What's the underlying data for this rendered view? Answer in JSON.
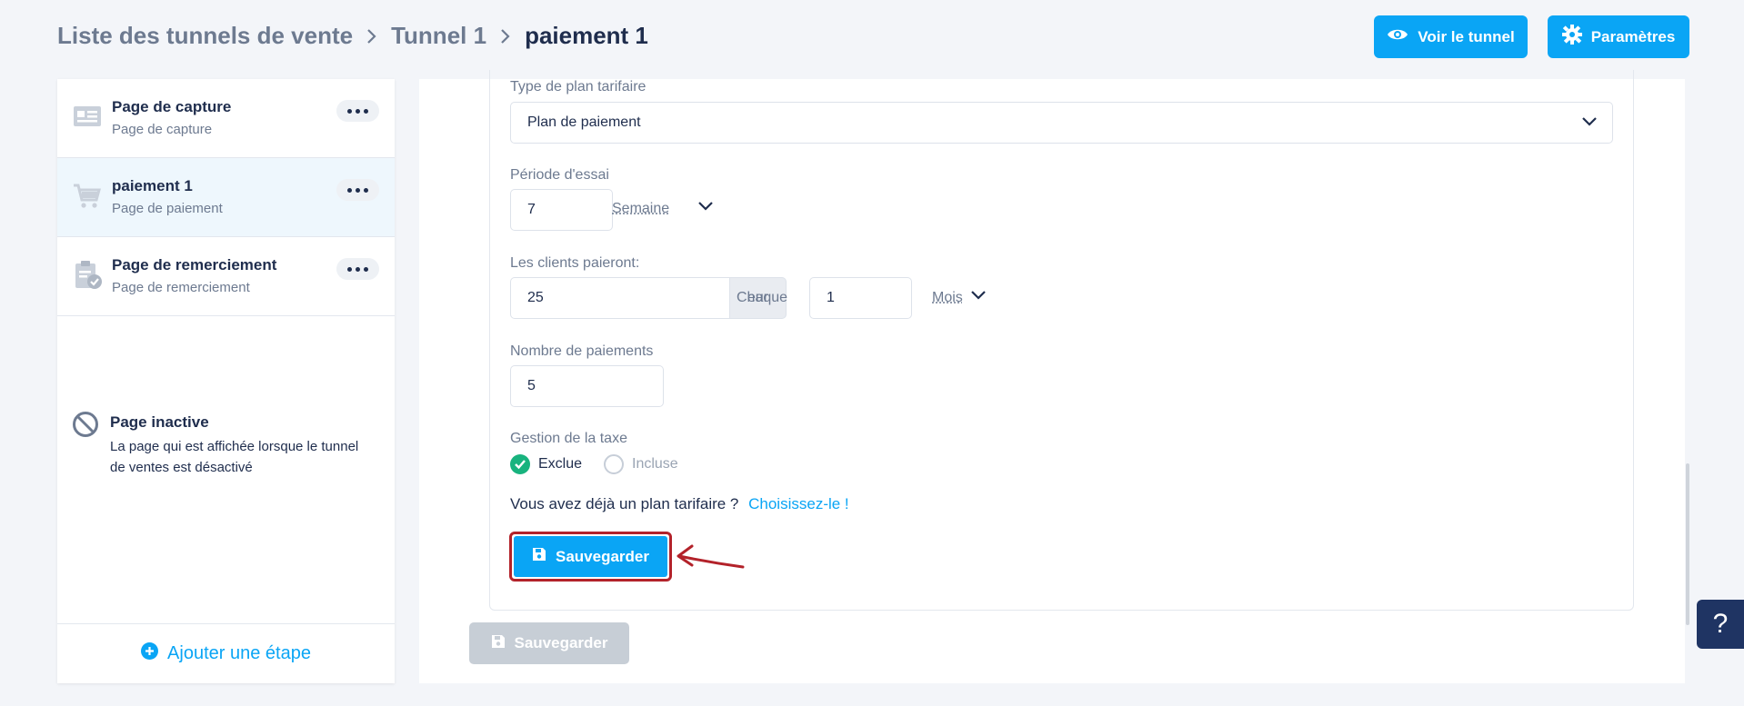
{
  "breadcrumb": {
    "items": [
      "Liste des tunnels de vente",
      "Tunnel 1"
    ],
    "current": "paiement 1"
  },
  "header": {
    "view_label": "Voir le tunnel",
    "settings_label": "Paramètres"
  },
  "sidebar": {
    "steps": [
      {
        "title": "Page de capture",
        "subtitle": "Page de capture",
        "icon": "capture-page-icon"
      },
      {
        "title": "paiement 1",
        "subtitle": "Page de paiement",
        "icon": "cart-icon"
      },
      {
        "title": "Page de remerciement",
        "subtitle": "Page de remerciement",
        "icon": "clipboard-check-icon"
      }
    ],
    "inactive": {
      "title": "Page inactive",
      "description": "La page qui est affichée lorsque le tunnel de ventes est désactivé",
      "icon": "ban-icon"
    },
    "add_step": "Ajouter une étape"
  },
  "form": {
    "plan_type_label": "Type de plan tarifaire",
    "plan_type_value": "Plan de paiement",
    "trial_label": "Période d'essai",
    "trial_value": "7",
    "trial_unit": "Semaine",
    "pay_label": "Les clients paieront:",
    "amount_value": "25",
    "currency": "eur",
    "every_label": "Chaque",
    "interval_value": "1",
    "interval_unit": "Mois",
    "payments_label": "Nombre de paiements",
    "payments_value": "5",
    "tax_label": "Gestion de la taxe",
    "tax_options": [
      "Exclue",
      "Incluse"
    ],
    "tax_selected": "Exclue",
    "existing_plan_text": "Vous avez déjà un plan tarifaire ?",
    "existing_plan_link": "Choisissez-le !",
    "save_label": "Sauvegarder"
  },
  "footer": {
    "save_label": "Sauvegarder"
  },
  "help_label": "?",
  "colors": {
    "primary": "#0aa5f5",
    "text": "#1f2d4d",
    "muted": "#6d7a90",
    "success": "#18b37e",
    "annotation": "#b3222a",
    "help_bg": "#1f3463"
  }
}
